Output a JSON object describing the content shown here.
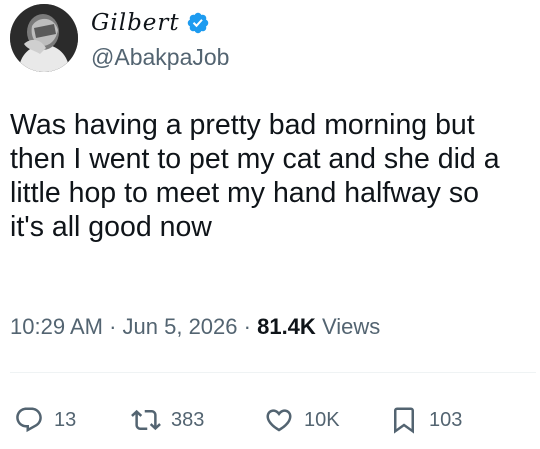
{
  "author": {
    "display_name": "Gilbert",
    "handle": "@AbakpaJob",
    "verified": true,
    "verified_color": "#1d9bf0"
  },
  "tweet": {
    "text": "Was having a pretty bad morning but\nthen I went to pet my cat and she did a\nlittle hop to meet my hand halfway so\nit's all good now"
  },
  "meta": {
    "time": "10:29 AM",
    "separator": "·",
    "date": "Jun 5, 2026",
    "views_count": "81.4K",
    "views_label": "Views"
  },
  "actions": {
    "reply": {
      "icon": "reply-icon",
      "count": "13"
    },
    "retweet": {
      "icon": "retweet-icon",
      "count": "383"
    },
    "like": {
      "icon": "heart-icon",
      "count": "10K"
    },
    "bookmark": {
      "icon": "bookmark-icon",
      "count": "103"
    }
  },
  "colors": {
    "text": "#0f1419",
    "secondary": "#536471",
    "divider": "#eff3f4"
  }
}
